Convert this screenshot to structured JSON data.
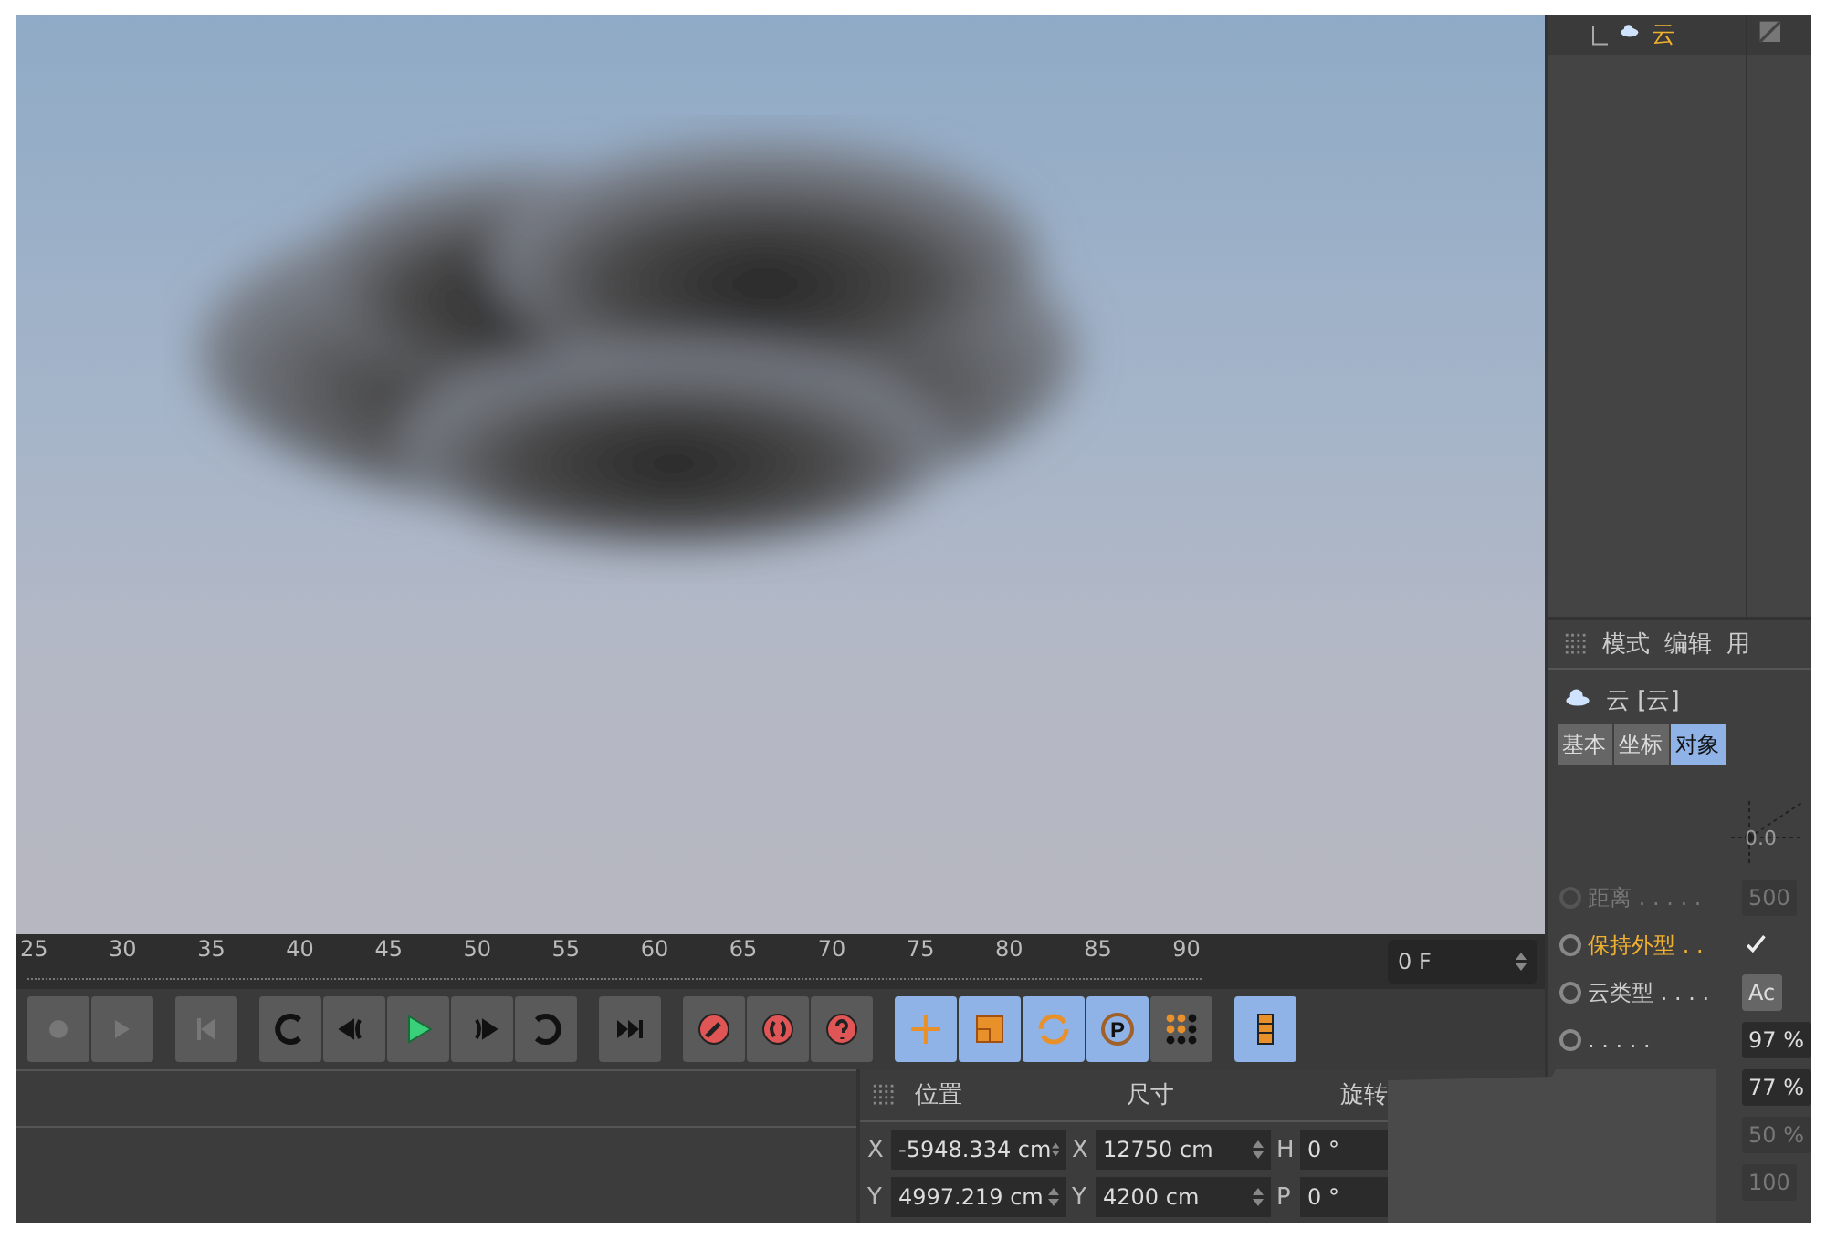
{
  "object_manager": {
    "items": [
      {
        "name": "云",
        "selected": true
      }
    ]
  },
  "timeline": {
    "ticks": [
      "25",
      "30",
      "35",
      "40",
      "45",
      "50",
      "55",
      "60",
      "65",
      "70",
      "75",
      "80",
      "85",
      "90"
    ],
    "current_frame": "0 F"
  },
  "tool_toggles": [
    {
      "kind": "move",
      "on": true
    },
    {
      "kind": "scale",
      "on": true
    },
    {
      "kind": "rotate",
      "on": true
    },
    {
      "kind": "param",
      "on": true,
      "label": "P"
    },
    {
      "kind": "dots",
      "on": false
    }
  ],
  "film_toggle": {
    "on": true
  },
  "coordinates": {
    "headers": [
      "位置",
      "尺寸",
      "旋转"
    ],
    "rows": [
      [
        {
          "axis": "X",
          "value": "-5948.334 cm"
        },
        {
          "axis": "X",
          "value": "12750 cm"
        },
        {
          "axis": "H",
          "value": "0 °"
        }
      ],
      [
        {
          "axis": "Y",
          "value": "4997.219 cm"
        },
        {
          "axis": "Y",
          "value": "4200 cm"
        },
        {
          "axis": "P",
          "value": "0 °"
        }
      ]
    ]
  },
  "attribute_manager": {
    "menu": [
      "模式",
      "编辑",
      "用"
    ],
    "title": "云 [云]",
    "tabs": [
      {
        "label": "基本",
        "selected": false
      },
      {
        "label": "坐标",
        "selected": false
      },
      {
        "label": "对象",
        "selected": true
      }
    ],
    "graph_label": "0.0",
    "params": [
      {
        "kind": "field",
        "label": "距离 . . . . .",
        "value": "500",
        "disabled": true,
        "highlighted": false
      },
      {
        "kind": "checkbox",
        "label": "保持外型 . .",
        "checked": true,
        "disabled": false,
        "highlighted": true
      },
      {
        "kind": "dropdown",
        "label": "云类型 . . . .",
        "value": "Ac",
        "disabled": false,
        "highlighted": false
      },
      {
        "kind": "field",
        "label": ". . . . .",
        "value": "97 %",
        "disabled": false,
        "highlighted": false
      },
      {
        "kind": "field",
        "value": "77 %",
        "disabled": false
      },
      {
        "kind": "field",
        "value": "50 %",
        "disabled": true
      },
      {
        "kind": "field",
        "value": "100",
        "disabled": true
      }
    ]
  }
}
